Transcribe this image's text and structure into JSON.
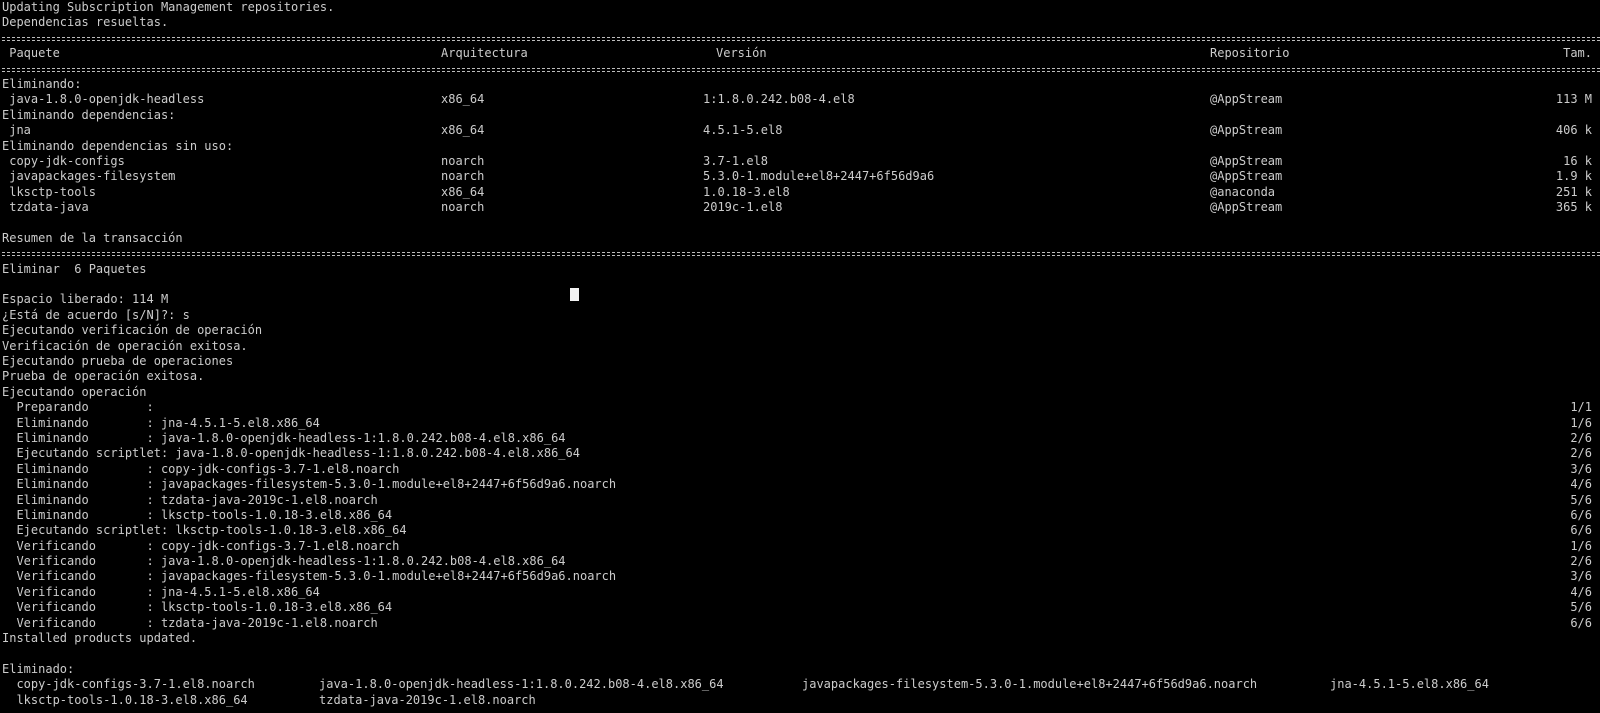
{
  "console": {
    "intro": [
      "Updating Subscription Management repositories.",
      "Dependencias resueltas."
    ],
    "table": {
      "headers": {
        "package": " Paquete",
        "arch": "Arquitectura",
        "version": "Versión",
        "repo": "Repositorio",
        "size": "Tam."
      },
      "groups": [
        {
          "heading": "Eliminando:",
          "rows": [
            {
              "package": " java-1.8.0-openjdk-headless",
              "arch": "x86_64",
              "version": "1:1.8.0.242.b08-4.el8",
              "repo": "@AppStream",
              "size": "113 M"
            }
          ]
        },
        {
          "heading": "Eliminando dependencias:",
          "rows": [
            {
              "package": " jna",
              "arch": "x86_64",
              "version": "4.5.1-5.el8",
              "repo": "@AppStream",
              "size": "406 k"
            }
          ]
        },
        {
          "heading": "Eliminando dependencias sin uso:",
          "rows": [
            {
              "package": " copy-jdk-configs",
              "arch": "noarch",
              "version": "3.7-1.el8",
              "repo": "@AppStream",
              "size": "16 k"
            },
            {
              "package": " javapackages-filesystem",
              "arch": "noarch",
              "version": "5.3.0-1.module+el8+2447+6f56d9a6",
              "repo": "@AppStream",
              "size": "1.9 k"
            },
            {
              "package": " lksctp-tools",
              "arch": "x86_64",
              "version": "1.0.18-3.el8",
              "repo": "@anaconda",
              "size": "251 k"
            },
            {
              "package": " tzdata-java",
              "arch": "noarch",
              "version": "2019c-1.el8",
              "repo": "@AppStream",
              "size": "365 k"
            }
          ]
        }
      ]
    },
    "summary_title": "Resumen de la transacción",
    "remove_line": "Eliminar  6 Paquetes",
    "freed_space": "Espacio liberado: 114 M",
    "prompt": "¿Está de acuerdo [s/N]?: s",
    "steps": [
      "Ejecutando verificación de operación",
      "Verificación de operación exitosa.",
      "Ejecutando prueba de operaciones",
      "Prueba de operación exitosa.",
      "Ejecutando operación"
    ],
    "operations": [
      {
        "text": "  Preparando        :",
        "count": "1/1"
      },
      {
        "text": "  Eliminando        : jna-4.5.1-5.el8.x86_64",
        "count": "1/6"
      },
      {
        "text": "  Eliminando        : java-1.8.0-openjdk-headless-1:1.8.0.242.b08-4.el8.x86_64",
        "count": "2/6"
      },
      {
        "text": "  Ejecutando scriptlet: java-1.8.0-openjdk-headless-1:1.8.0.242.b08-4.el8.x86_64",
        "count": "2/6"
      },
      {
        "text": "  Eliminando        : copy-jdk-configs-3.7-1.el8.noarch",
        "count": "3/6"
      },
      {
        "text": "  Eliminando        : javapackages-filesystem-5.3.0-1.module+el8+2447+6f56d9a6.noarch",
        "count": "4/6"
      },
      {
        "text": "  Eliminando        : tzdata-java-2019c-1.el8.noarch",
        "count": "5/6"
      },
      {
        "text": "  Eliminando        : lksctp-tools-1.0.18-3.el8.x86_64",
        "count": "6/6"
      },
      {
        "text": "  Ejecutando scriptlet: lksctp-tools-1.0.18-3.el8.x86_64",
        "count": "6/6"
      },
      {
        "text": "  Verificando       : copy-jdk-configs-3.7-1.el8.noarch",
        "count": "1/6"
      },
      {
        "text": "  Verificando       : java-1.8.0-openjdk-headless-1:1.8.0.242.b08-4.el8.x86_64",
        "count": "2/6"
      },
      {
        "text": "  Verificando       : javapackages-filesystem-5.3.0-1.module+el8+2447+6f56d9a6.noarch",
        "count": "3/6"
      },
      {
        "text": "  Verificando       : jna-4.5.1-5.el8.x86_64",
        "count": "4/6"
      },
      {
        "text": "  Verificando       : lksctp-tools-1.0.18-3.el8.x86_64",
        "count": "5/6"
      },
      {
        "text": "  Verificando       : tzdata-java-2019c-1.el8.noarch",
        "count": "6/6"
      }
    ],
    "installed_updated": "Installed products updated.",
    "removed_title": "Eliminado:",
    "removed": [
      [
        "  copy-jdk-configs-3.7-1.el8.noarch",
        "java-1.8.0-openjdk-headless-1:1.8.0.242.b08-4.el8.x86_64",
        "javapackages-filesystem-5.3.0-1.module+el8+2447+6f56d9a6.noarch",
        "jna-4.5.1-5.el8.x86_64"
      ],
      [
        "  lksctp-tools-1.0.18-3.el8.x86_64",
        "tzdata-java-2019c-1.el8.noarch"
      ]
    ],
    "colors": {
      "background": "#000000",
      "text": "#cccccc",
      "cursor": "#f2f2f2"
    }
  }
}
